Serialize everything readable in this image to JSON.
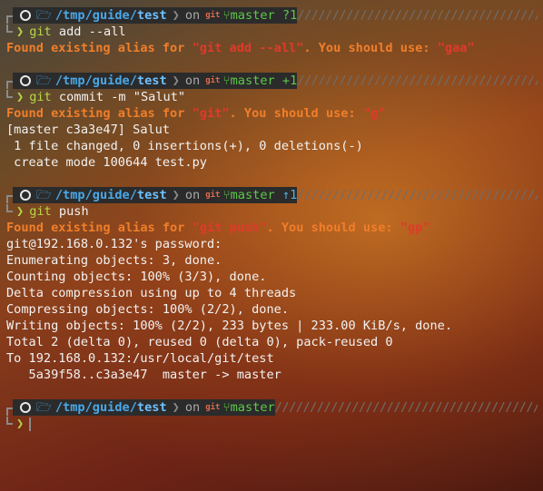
{
  "prompt": {
    "path_prefix": "/tmp/guide/",
    "path_dir": "test",
    "on": "on",
    "git_label": "git",
    "branch": "master",
    "fill": "////////////////////////////////////////"
  },
  "blocks": [
    {
      "status": "?1",
      "command_word": "git",
      "command_rest": " add --all",
      "alias_msg_start": "Found existing alias for ",
      "alias_cmd": "\"git add --all\"",
      "alias_msg_mid": ". You should use: ",
      "alias_suggest": "\"gaa\"",
      "output": []
    },
    {
      "status": "+1",
      "command_word": "git",
      "command_rest": " commit -m \"Salut\"",
      "alias_msg_start": "Found existing alias for ",
      "alias_cmd": "\"git\"",
      "alias_msg_mid": ". You should use: ",
      "alias_suggest": "\"g\"",
      "output": [
        "[master c3a3e47] Salut",
        " 1 file changed, 0 insertions(+), 0 deletions(-)",
        " create mode 100644 test.py"
      ]
    },
    {
      "status": "↑1",
      "command_word": "git",
      "command_rest": " push",
      "alias_msg_start": "Found existing alias for ",
      "alias_cmd": "\"git push\"",
      "alias_msg_mid": ". You should use: ",
      "alias_suggest": "\"gp\"",
      "output": [
        "git@192.168.0.132's password:",
        "Enumerating objects: 3, done.",
        "Counting objects: 100% (3/3), done.",
        "Delta compression using up to 4 threads",
        "Compressing objects: 100% (2/2), done.",
        "Writing objects: 100% (2/2), 233 bytes | 233.00 KiB/s, done.",
        "Total 2 (delta 0), reused 0 (delta 0), pack-reused 0",
        "To 192.168.0.132:/usr/local/git/test",
        "   5a39f58..c3a3e47  master -> master"
      ]
    }
  ],
  "final_prompt": {
    "status": ""
  },
  "colors": {
    "path": "#4aa8e8",
    "branch": "#5fc84a",
    "warning": "#f07e2a",
    "alias_highlight": "#e03a2a",
    "prompt_arrow": "#b6d744"
  }
}
